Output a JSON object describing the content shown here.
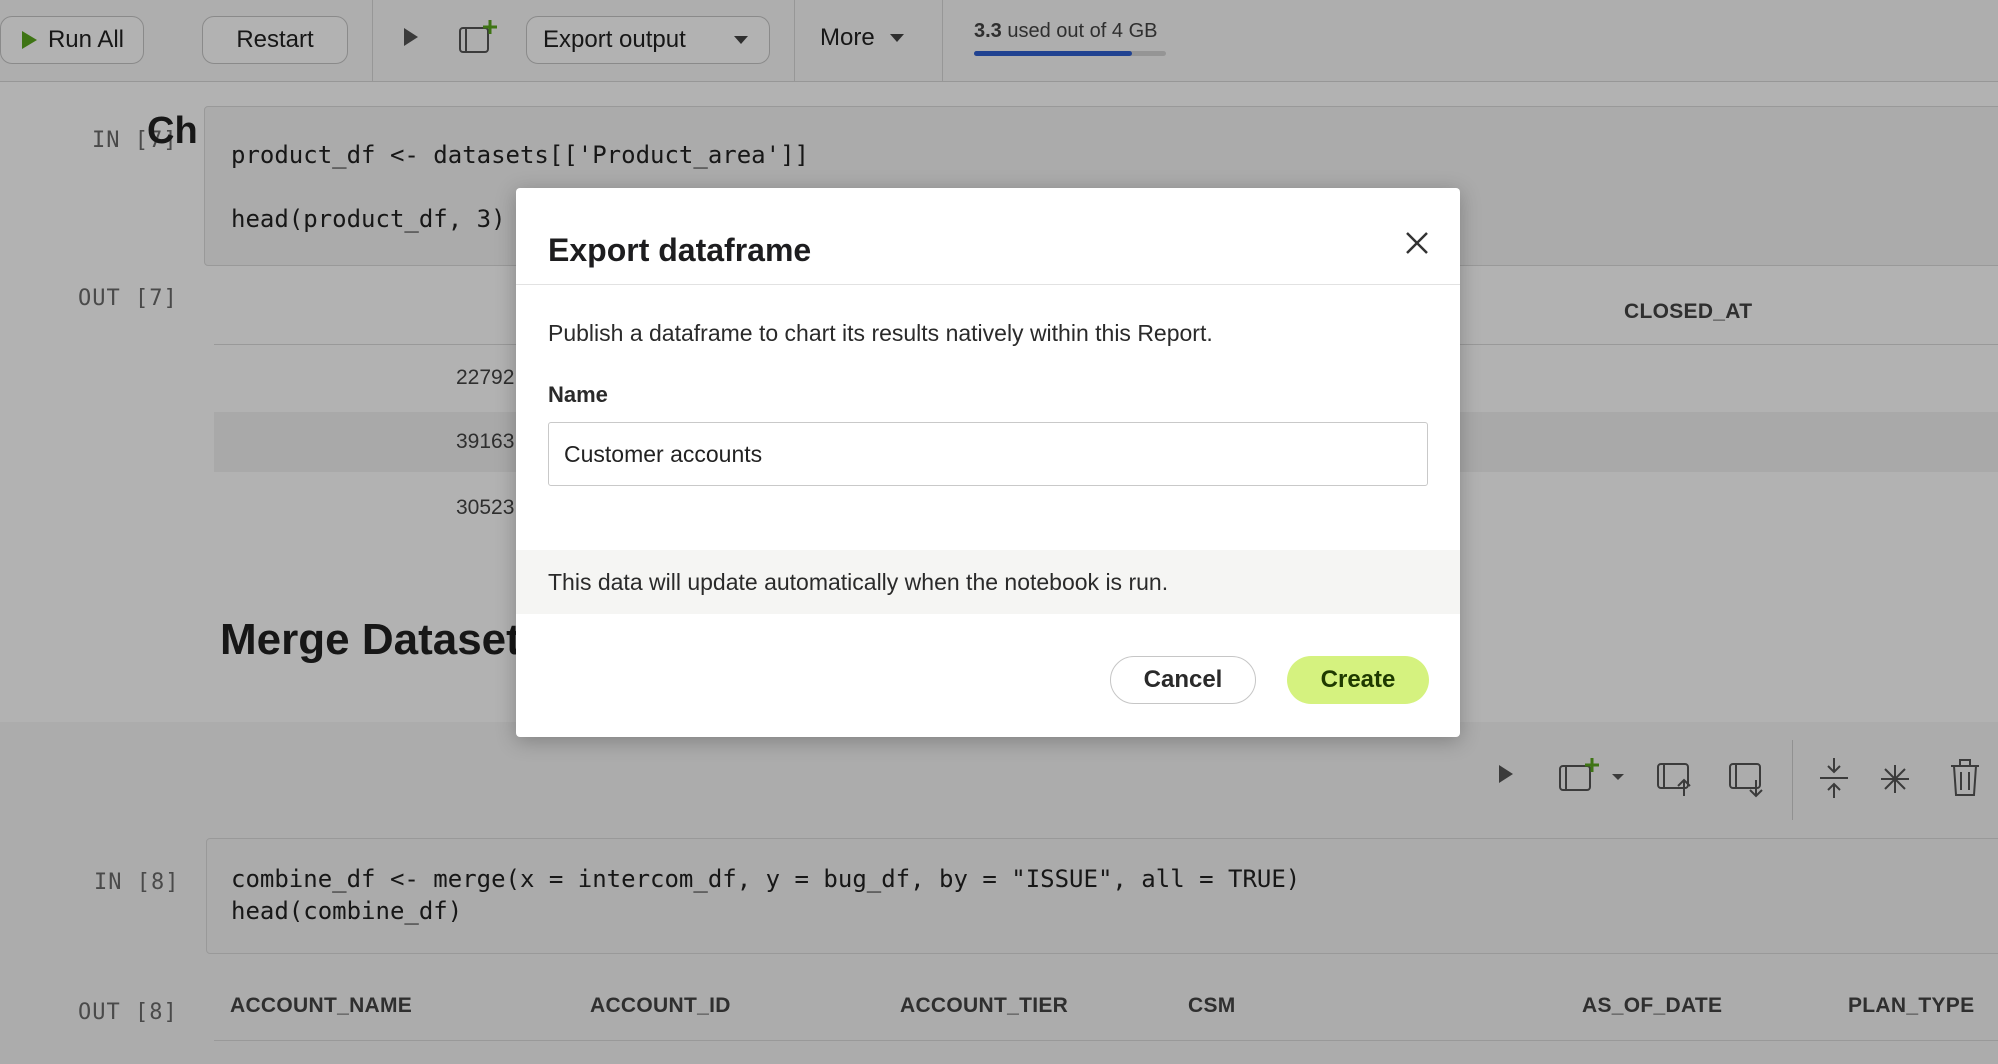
{
  "toolbar": {
    "run_all_label": "Run All",
    "restart_label": "Restart",
    "export_output_label": "Export output",
    "more_label": "More",
    "memory_used": "3.3",
    "memory_text": "used out of 4 GB",
    "memory_fraction": 0.825
  },
  "cells": [
    {
      "in_label": "IN [7]",
      "code_lines": [
        "product_df <- datasets[['Product_area']]",
        "",
        "head(product_df, 3)"
      ],
      "out_label": "OUT [7]",
      "columns": [
        "CLOSED_AT"
      ],
      "rows": [
        "22792",
        "39163",
        "30523"
      ]
    },
    {
      "in_label": "IN [8]",
      "code_lines": [
        "combine_df <- merge(x = intercom_df, y = bug_df, by = \"ISSUE\", all = TRUE)",
        "head(combine_df)"
      ],
      "out_label": "OUT [8]",
      "columns": [
        "ACCOUNT_NAME",
        "ACCOUNT_ID",
        "ACCOUNT_TIER",
        "CSM",
        "AS_OF_DATE",
        "PLAN_TYPE"
      ]
    }
  ],
  "headings": {
    "partial_heading": "Ch",
    "merge_heading": "Merge Datasets"
  },
  "modal": {
    "title": "Export dataframe",
    "description": "Publish a dataframe to chart its results natively within this Report.",
    "name_label": "Name",
    "name_value": "Customer accounts",
    "note": "This data will update automatically when the notebook is run.",
    "cancel_label": "Cancel",
    "create_label": "Create"
  },
  "colors": {
    "accent_green": "#d5f27f",
    "run_icon_green": "#5aa61e",
    "memory_bar": "#2f5fd0"
  }
}
